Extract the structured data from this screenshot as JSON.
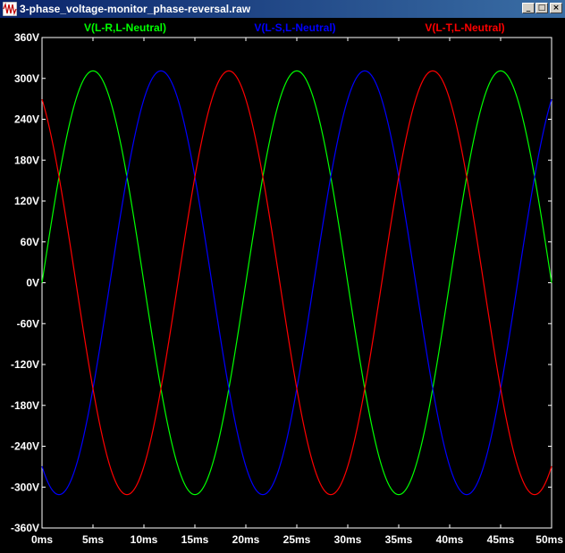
{
  "window": {
    "title": "3-phase_voltage-monitor_phase-reversal.raw",
    "icon": "waveform-icon",
    "buttons": {
      "minimize": "_",
      "maximize": "□",
      "close": "×"
    }
  },
  "chart_data": {
    "type": "line",
    "title": "",
    "xlabel": "",
    "ylabel": "",
    "xlim": [
      0,
      50
    ],
    "ylim": [
      -360,
      360
    ],
    "x_unit": "ms",
    "y_unit": "V",
    "x_ticks": [
      "0ms",
      "5ms",
      "10ms",
      "15ms",
      "20ms",
      "25ms",
      "30ms",
      "35ms",
      "40ms",
      "45ms",
      "50ms"
    ],
    "y_ticks": [
      "360V",
      "300V",
      "240V",
      "180V",
      "120V",
      "60V",
      "0V",
      "-60V",
      "-120V",
      "-180V",
      "-240V",
      "-300V",
      "-360V"
    ],
    "grid": false,
    "legend_position": "top",
    "series": [
      {
        "name": "V(L-R,L-Neutral)",
        "color": "#00ff00",
        "amplitude": 311,
        "frequency_hz": 50,
        "phase_deg": 0
      },
      {
        "name": "V(L-S,L-Neutral)",
        "color": "#0000ff",
        "amplitude": 311,
        "frequency_hz": 50,
        "phase_deg": -120
      },
      {
        "name": "V(L-T,L-Neutral)",
        "color": "#ff0000",
        "amplitude": 311,
        "frequency_hz": 50,
        "phase_deg": 120
      }
    ]
  }
}
